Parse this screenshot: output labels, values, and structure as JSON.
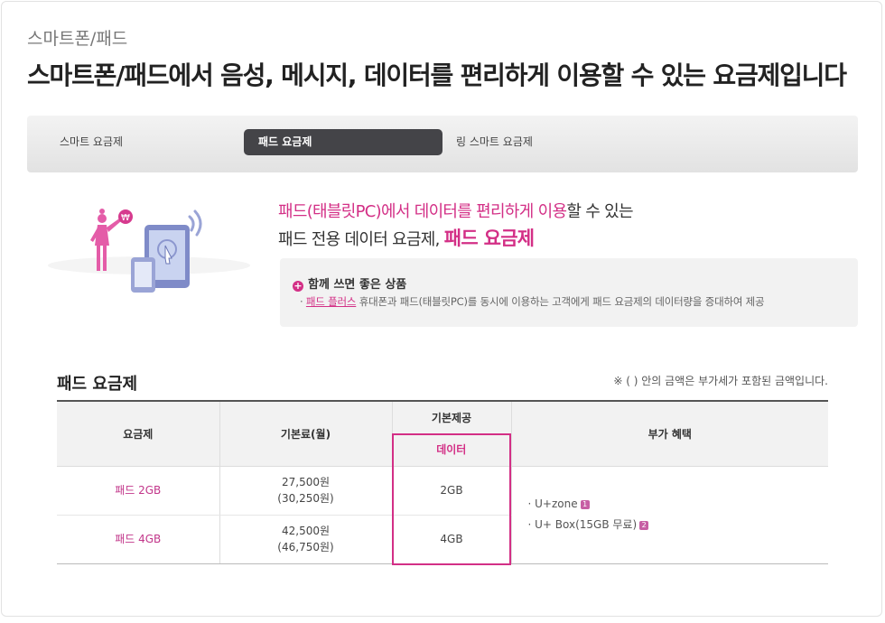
{
  "breadcrumb": "스마트폰/패드",
  "headline": "스마트폰/패드에서 음성, 메시지, 데이터를 편리하게 이용할 수 있는 요금제입니다",
  "tabs": [
    {
      "label": "스마트 요금제",
      "active": false
    },
    {
      "label": "패드 요금제",
      "active": true
    },
    {
      "label": "링 스마트 요금제",
      "active": false
    }
  ],
  "hero": {
    "line1_highlight": "패드(태블릿PC)에서 데이터를 편리하게 이용",
    "line1_rest": "할 수 있는",
    "line2_prefix": "패드 전용 데이터 요금제,",
    "line2_highlight": "패드 요금제"
  },
  "info": {
    "title": "함께 쓰면 좋은 상품",
    "link": "패드 플러스",
    "desc": "휴대폰과 패드(태블릿PC)를 동시에 이용하는 고객에게 패드 요금제의 데이터량을 증대하여 제공"
  },
  "section": {
    "title": "패드 요금제",
    "note": "※ ( ) 안의 금액은 부가세가 포함된 금액입니다."
  },
  "table": {
    "headers": {
      "plan": "요금제",
      "fee": "기본료(월)",
      "basic": "기본제공",
      "data": "데이터",
      "benefit": "부가 혜택"
    },
    "rows": [
      {
        "plan": "패드 2GB",
        "fee": "27,500원",
        "fee_vat": "(30,250원)",
        "data": "2GB"
      },
      {
        "plan": "패드 4GB",
        "fee": "42,500원",
        "fee_vat": "(46,750원)",
        "data": "4GB"
      }
    ],
    "benefits": [
      {
        "text": "U+zone",
        "badge": "1"
      },
      {
        "text": "U+ Box(15GB 무료)",
        "badge": "2"
      }
    ]
  },
  "colors": {
    "accent": "#d32f86",
    "tab_active": "#444448",
    "plan_text": "#c2368a"
  }
}
